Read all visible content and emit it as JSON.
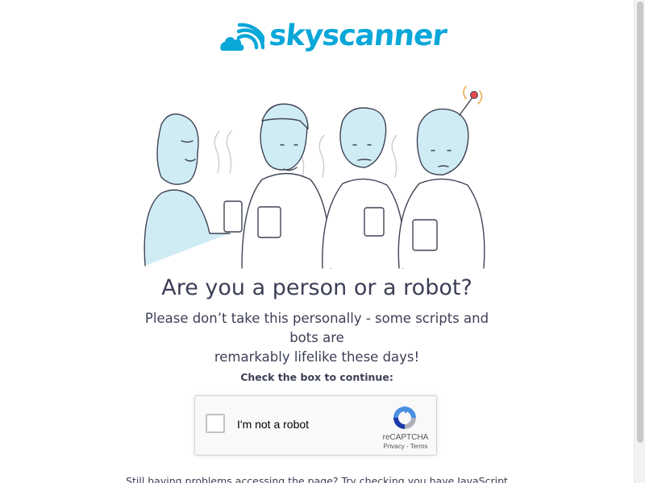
{
  "brand": {
    "name": "skyscanner",
    "color": "#0aa7d9"
  },
  "heading": {
    "title": "Are you a person or a robot?"
  },
  "message": {
    "line1": "Please don’t take this personally - some scripts and bots are",
    "line2": "remarkably lifelike these days!"
  },
  "instruction": "Check the box to continue:",
  "captcha": {
    "label": "I'm not a robot",
    "checked": false,
    "brand": "reCAPTCHA",
    "privacy": "Privacy",
    "separator": " - ",
    "terms": "Terms"
  },
  "footer": {
    "text": "Still having problems accessing the page? Try checking you have JavaScript"
  },
  "colors": {
    "text": "#3c3f55",
    "illustration_fill": "#cfecf5",
    "illustration_stroke": "#3f4454",
    "robot_antenna": "#e84a4a"
  }
}
